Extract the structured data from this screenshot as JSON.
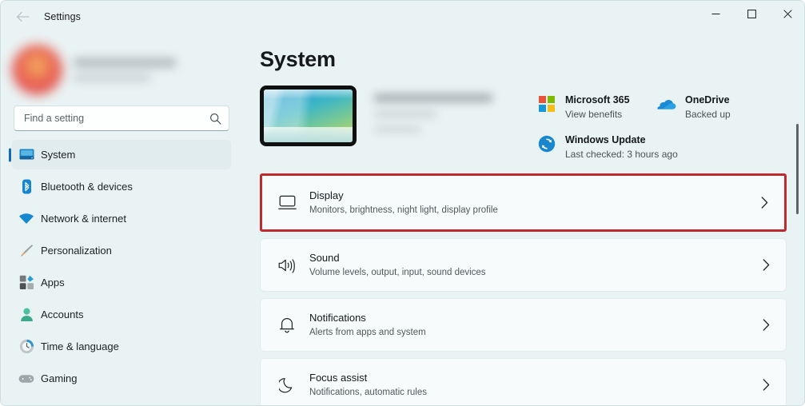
{
  "window": {
    "app_title": "Settings",
    "back_icon": "arrow-left-icon",
    "controls": {
      "minimize": "—",
      "maximize": "□",
      "close": "✕"
    }
  },
  "sidebar": {
    "account": {
      "avatar": "user-avatar-blurred",
      "name_redacted": true
    },
    "search": {
      "placeholder": "Find a setting",
      "value": "",
      "icon": "search-icon"
    },
    "items": [
      {
        "label": "System",
        "icon": "monitor-icon",
        "selected": true
      },
      {
        "label": "Bluetooth & devices",
        "icon": "bluetooth-icon",
        "selected": false
      },
      {
        "label": "Network & internet",
        "icon": "wifi-icon",
        "selected": false
      },
      {
        "label": "Personalization",
        "icon": "paintbrush-icon",
        "selected": false
      },
      {
        "label": "Apps",
        "icon": "apps-grid-icon",
        "selected": false
      },
      {
        "label": "Accounts",
        "icon": "person-icon",
        "selected": false
      },
      {
        "label": "Time & language",
        "icon": "clock-icon",
        "selected": false
      },
      {
        "label": "Gaming",
        "icon": "gamepad-icon",
        "selected": false
      }
    ]
  },
  "main": {
    "page_title": "System",
    "device": {
      "thumbnail": "device-wallpaper-thumbnail",
      "name_redacted": true
    },
    "status_cards": [
      {
        "name": "Microsoft 365",
        "sub": "View benefits",
        "icon": "microsoft-logo-icon"
      },
      {
        "name": "OneDrive",
        "sub": "Backed up",
        "icon": "onedrive-cloud-icon"
      },
      {
        "name": "Windows Update",
        "sub": "Last checked: 3 hours ago",
        "icon": "sync-refresh-icon"
      }
    ],
    "settings_rows": [
      {
        "title": "Display",
        "sub": "Monitors, brightness, night light, display profile",
        "icon": "monitor-outline-icon",
        "highlighted": true
      },
      {
        "title": "Sound",
        "sub": "Volume levels, output, input, sound devices",
        "icon": "speaker-icon",
        "highlighted": false
      },
      {
        "title": "Notifications",
        "sub": "Alerts from apps and system",
        "icon": "bell-icon",
        "highlighted": false
      },
      {
        "title": "Focus assist",
        "sub": "Notifications, automatic rules",
        "icon": "moon-icon",
        "highlighted": false
      }
    ],
    "chevron_icon": "chevron-right-icon"
  },
  "colors": {
    "background": "#eaf3f4",
    "card": "#f7fbfb",
    "accent": "#0f6cbd",
    "highlight_border": "#bf2a2f"
  }
}
